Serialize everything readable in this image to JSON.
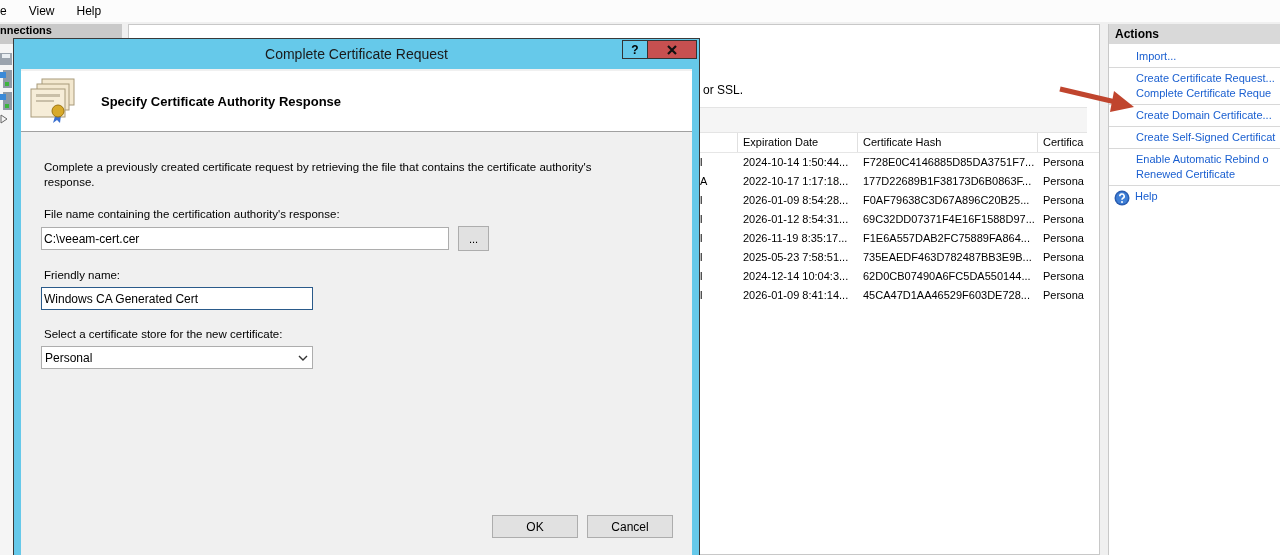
{
  "menu_bar": [
    "e",
    "View",
    "Help"
  ],
  "connections": {
    "title": "nnections"
  },
  "center": {
    "description_tail": "or SSL.",
    "table": {
      "columns": [
        "",
        "Expiration Date",
        "Certificate Hash",
        "Certifica"
      ],
      "rows": [
        [
          "l",
          "2024-10-14 1:50:44...",
          "F728E0C4146885D85DA3751F7...",
          "Persona"
        ],
        [
          "A",
          "2022-10-17 1:17:18...",
          "177D22689B1F38173D6B0863F...",
          "Persona"
        ],
        [
          "l",
          "2026-01-09 8:54:28...",
          "F0AF79638C3D67A896C20B25...",
          "Persona"
        ],
        [
          "l",
          "2026-01-12 8:54:31...",
          "69C32DD07371F4E16F1588D97...",
          "Persona"
        ],
        [
          "l",
          "2026-11-19 8:35:17...",
          "F1E6A557DAB2FC75889FA864...",
          "Persona"
        ],
        [
          "l",
          "2025-05-23 7:58:51...",
          "735EAEDF463D782487BB3E9B...",
          "Persona"
        ],
        [
          "l",
          "2024-12-14 10:04:3...",
          "62D0CB07490A6FC5DA550144...",
          "Persona"
        ],
        [
          "l",
          "2026-01-09 8:41:14...",
          "45CA47D1AA46529F603DE728...",
          "Persona"
        ]
      ]
    }
  },
  "actions": {
    "title": "Actions",
    "groups": [
      [
        {
          "kind": "link",
          "lines": [
            "Import..."
          ]
        }
      ],
      [
        {
          "kind": "link",
          "lines": [
            "Create Certificate Request..."
          ]
        },
        {
          "kind": "link",
          "lines": [
            "Complete Certificate Reque"
          ]
        }
      ],
      [
        {
          "kind": "link",
          "lines": [
            "Create Domain Certificate..."
          ]
        }
      ],
      [
        {
          "kind": "link",
          "lines": [
            "Create Self-Signed Certificat"
          ]
        }
      ],
      [
        {
          "kind": "link",
          "lines": [
            "Enable Automatic Rebind o",
            "Renewed Certificate"
          ]
        }
      ],
      [
        {
          "kind": "help",
          "lines": [
            "Help"
          ]
        }
      ]
    ]
  },
  "dialog": {
    "title": "Complete Certificate Request",
    "help_button": "?",
    "header": "Specify Certificate Authority Response",
    "description": "Complete a previously created certificate request by retrieving the file that contains the certificate authority's response.",
    "fields": [
      {
        "kind": "file",
        "label": "File name containing the certification authority's response:",
        "value": "C:\\veeam-cert.cer",
        "browse": "...",
        "focused": false
      },
      {
        "kind": "text",
        "label": "Friendly name:",
        "value": "Windows CA Generated Cert",
        "focused": true
      },
      {
        "kind": "select",
        "label": "Select a certificate store for the new certificate:",
        "value": "Personal",
        "focused": false
      }
    ],
    "buttons": [
      "OK",
      "Cancel"
    ]
  }
}
